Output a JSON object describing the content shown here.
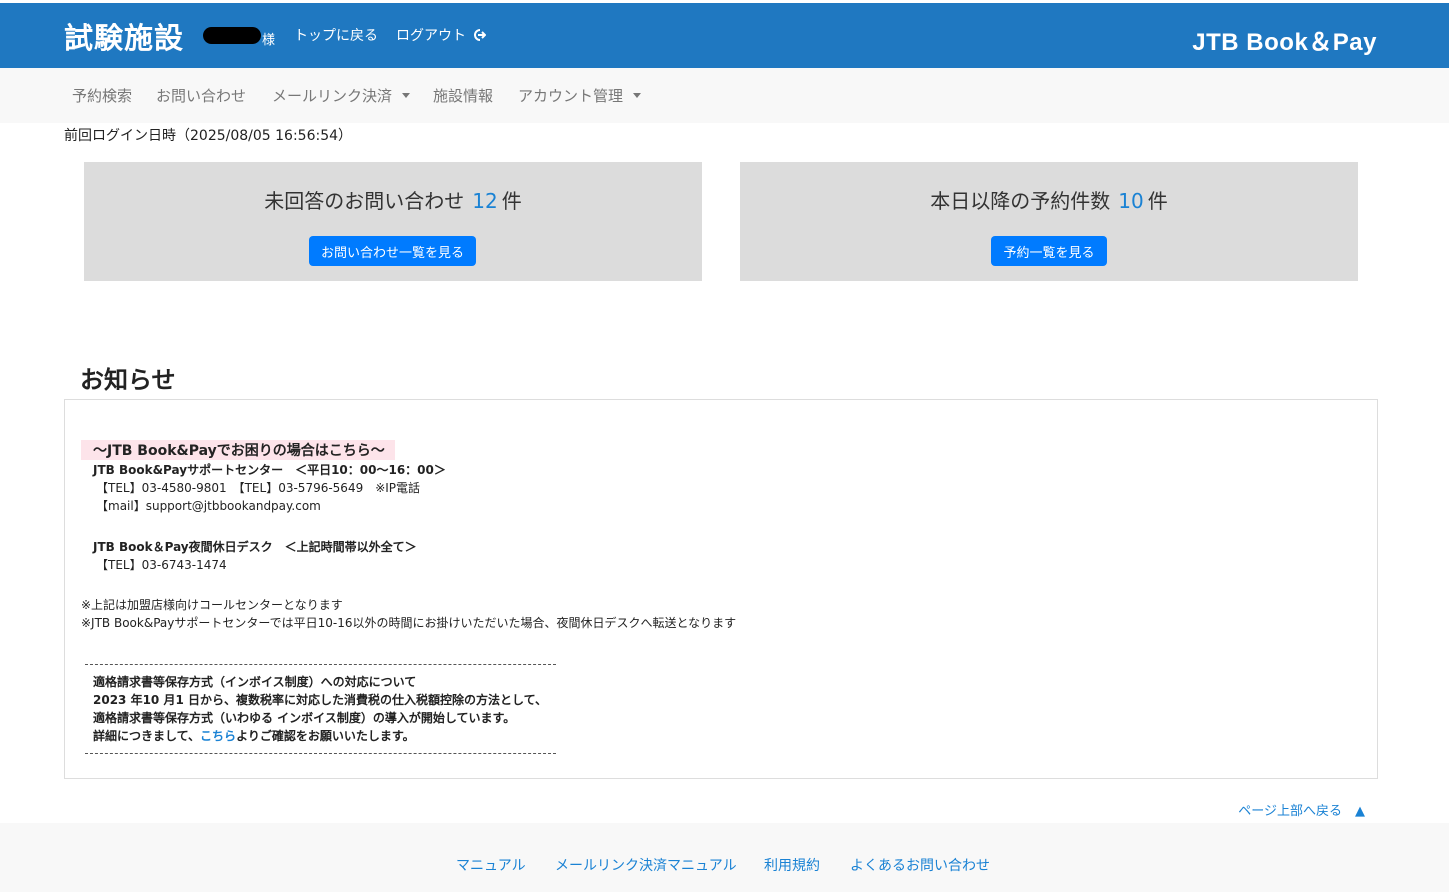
{
  "header": {
    "facility_name": "試験施設",
    "user_suffix": "様",
    "back_to_top": "トップに戻る",
    "logout": "ログアウト",
    "brand": "JTB Book＆Pay"
  },
  "menu": {
    "items": [
      {
        "label": "予約検索"
      },
      {
        "label": "お問い合わせ"
      },
      {
        "label": "メールリンク決済"
      },
      {
        "label": "施設情報"
      },
      {
        "label": "アカウント管理"
      }
    ]
  },
  "last_login": "前回ログイン日時（2025/08/05 16:56:54）",
  "cards": [
    {
      "title": "未回答のお問い合わせ",
      "count": "12",
      "unit": "件",
      "button": "お問い合わせ一覧を見る"
    },
    {
      "title": "本日以降の予約件数",
      "count": "10",
      "unit": "件",
      "button": "予約一覧を見る"
    }
  ],
  "news": {
    "heading": "お知らせ",
    "help_title": "～JTB Book&Payでお困りの場合はこちら～",
    "support_center": "JTB Book&Payサポートセンター　＜平日10：00～16：00＞",
    "support_tel": "【TEL】03-4580-9801　【TEL】03-5796-5649　※IP電話",
    "support_mail": "【mail】support@jtbbookandpay.com",
    "night_desk": "JTB Book＆Pay夜間休日デスク　＜上記時間帯以外全て＞",
    "night_tel": "【TEL】03-6743-1474",
    "note1": "※上記は加盟店様向けコールセンターとなります",
    "note2": "※JTB Book&Payサポートセンターでは平日10-16以外の時間にお掛けいただいた場合、夜間休日デスクへ転送となります",
    "invoice_title": "適格請求書等保存方式（インボイス制度）への対応について",
    "invoice_line1": "2023 年10 月1 日から、複数税率に対応した消費税の仕入税額控除の方法として、",
    "invoice_line2": "適格請求書等保存方式（いわゆる インボイス制度）の導入が開始しています。",
    "invoice_line3_pre": "詳細につきまして、",
    "invoice_link": "こちら",
    "invoice_line3_post": "よりご確認をお願いいたします。"
  },
  "back_to_page_top": "ページ上部へ戻る　▲",
  "footer": {
    "links": [
      {
        "label": "マニュアル"
      },
      {
        "label": "メールリンク決済マニュアル"
      },
      {
        "label": "利用規約"
      },
      {
        "label": "よくあるお問い合わせ"
      }
    ]
  },
  "colors": {
    "header_bg": "#1f78c1",
    "accent": "#007bff",
    "count": "#1a82d4",
    "card_bg": "#dcdcdc"
  }
}
